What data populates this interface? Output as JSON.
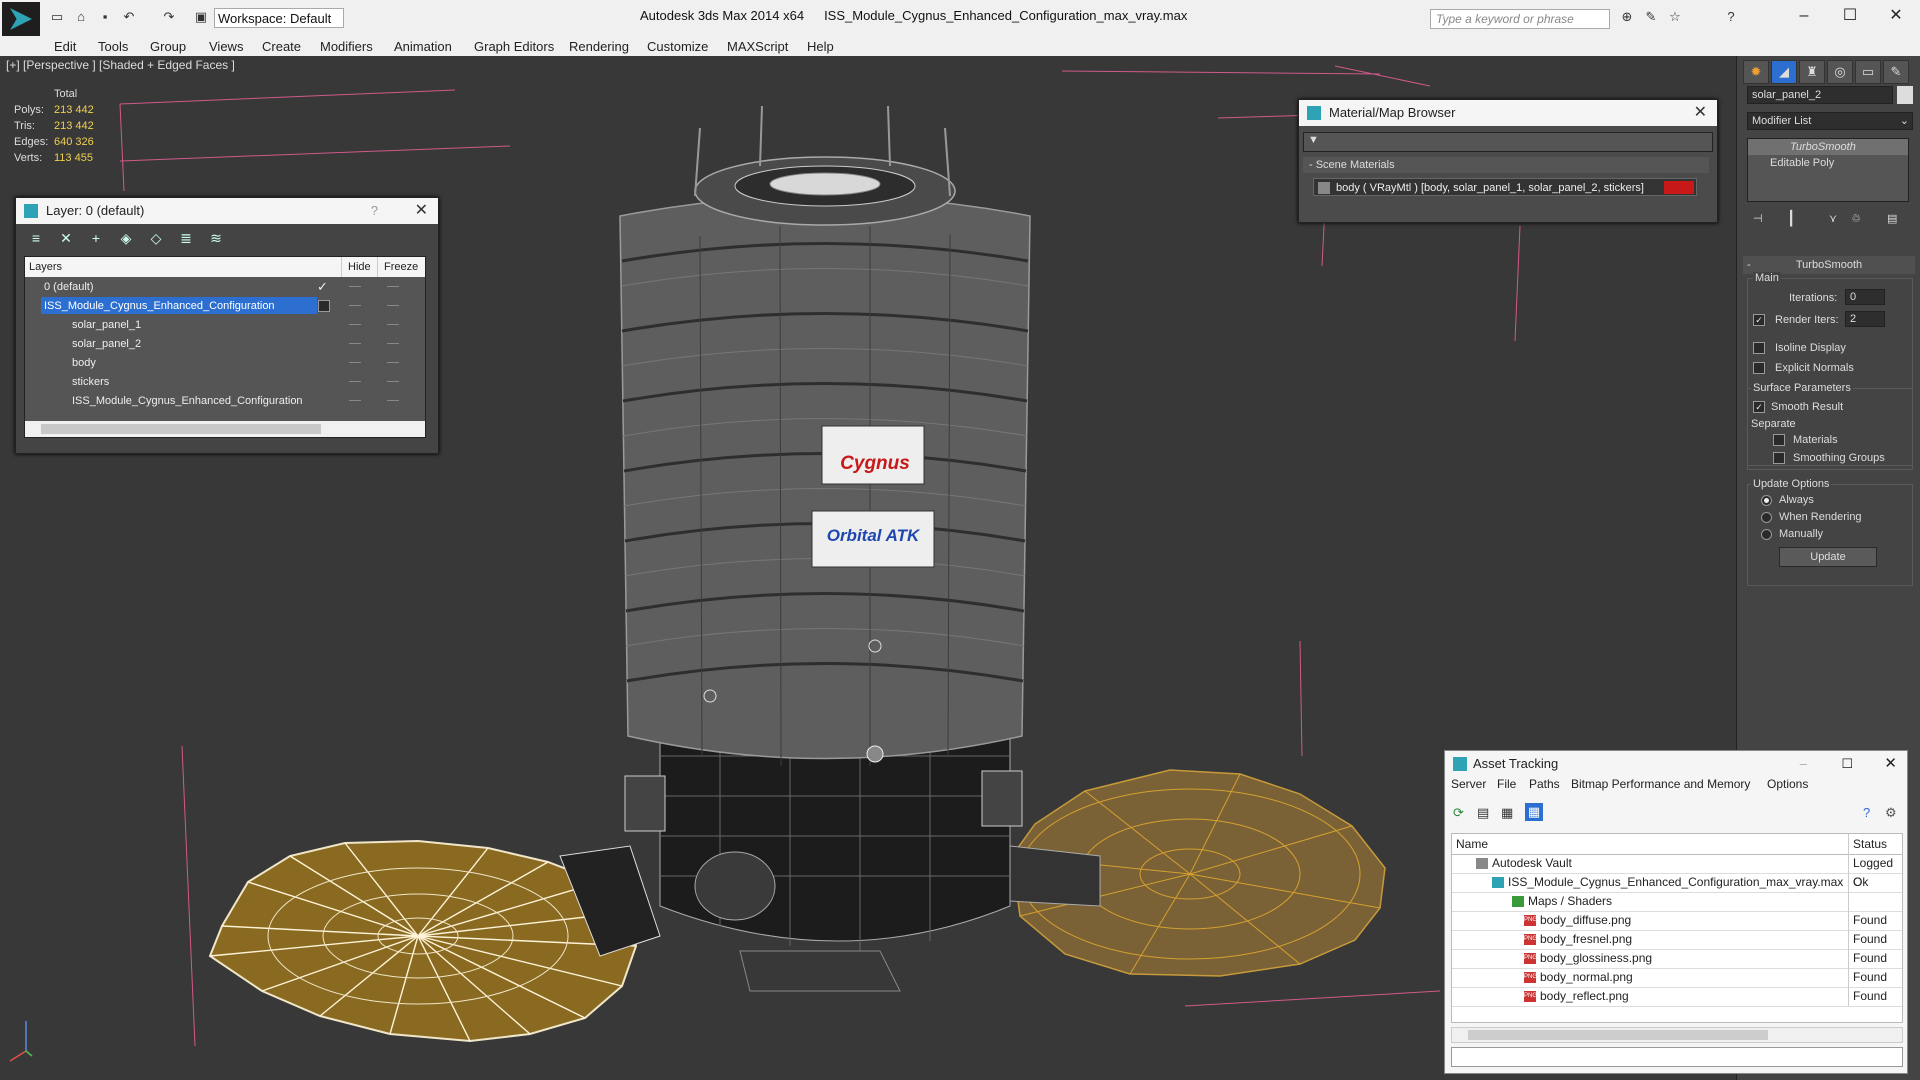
{
  "app": {
    "title": "Autodesk 3ds Max  2014 x64",
    "filename": "ISS_Module_Cygnus_Enhanced_Configuration_max_vray.max",
    "workspace": "Workspace: Default",
    "search_placeholder": "Type a keyword or phrase"
  },
  "menu": [
    "Edit",
    "Tools",
    "Group",
    "Views",
    "Create",
    "Modifiers",
    "Animation",
    "Graph Editors",
    "Rendering",
    "Customize",
    "MAXScript",
    "Help"
  ],
  "viewport": {
    "label": "[+] [Perspective ] [Shaded + Edged Faces ]",
    "stats": {
      "header": "Total",
      "rows": [
        {
          "k": "Polys:",
          "v": "213 442"
        },
        {
          "k": "Tris:",
          "v": "213 442"
        },
        {
          "k": "Edges:",
          "v": "640 326"
        },
        {
          "k": "Verts:",
          "v": "113 455"
        }
      ]
    },
    "decals": [
      "Cygnus",
      "Orbital ATK"
    ]
  },
  "layer_panel": {
    "title": "Layer: 0 (default)",
    "help": "?",
    "col_layers": "Layers",
    "col_hide": "Hide",
    "col_freeze": "Freeze",
    "rows": [
      {
        "name": "0 (default)",
        "indent": 0
      },
      {
        "name": "ISS_Module_Cygnus_Enhanced_Configuration",
        "indent": 0,
        "selected": true
      },
      {
        "name": "solar_panel_1",
        "indent": 1
      },
      {
        "name": "solar_panel_2",
        "indent": 1
      },
      {
        "name": "body",
        "indent": 1
      },
      {
        "name": "stickers",
        "indent": 1
      },
      {
        "name": "ISS_Module_Cygnus_Enhanced_Configuration",
        "indent": 1
      }
    ]
  },
  "material_browser": {
    "title": "Material/Map Browser",
    "section": "- Scene Materials",
    "item": "body  ( VRayMtl ) [body, solar_panel_1, solar_panel_2, stickers]",
    "swatch_color": "#c81818"
  },
  "command_panel": {
    "object_name": "solar_panel_2",
    "modifier_list": "Modifier List",
    "stack": [
      "TurboSmooth",
      "Editable Poly"
    ],
    "rollout_title": "TurboSmooth",
    "main_label": "Main",
    "iterations_label": "Iterations:",
    "iterations_value": "0",
    "render_iters_label": "Render Iters:",
    "render_iters_value": "2",
    "isoline": "Isoline Display",
    "explicit_normals": "Explicit Normals",
    "surface_params": "Surface Parameters",
    "smooth_result": "Smooth Result",
    "separate": "Separate",
    "materials": "Materials",
    "smoothing_groups": "Smoothing Groups",
    "update_options": "Update Options",
    "always": "Always",
    "when_rendering": "When Rendering",
    "manually": "Manually",
    "update_btn": "Update"
  },
  "asset_tracking": {
    "title": "Asset Tracking",
    "menu": [
      "Server",
      "File",
      "Paths",
      "Bitmap Performance and Memory",
      "Options"
    ],
    "col_name": "Name",
    "col_status": "Status",
    "rows": [
      {
        "name": "Autodesk Vault",
        "status": "Logged O",
        "indent": 1,
        "icon": "vault"
      },
      {
        "name": "ISS_Module_Cygnus_Enhanced_Configuration_max_vray.max",
        "status": "Ok",
        "indent": 2,
        "icon": "max"
      },
      {
        "name": "Maps / Shaders",
        "status": "",
        "indent": 3,
        "icon": "folder"
      },
      {
        "name": "body_diffuse.png",
        "status": "Found",
        "indent": 4,
        "icon": "png"
      },
      {
        "name": "body_fresnel.png",
        "status": "Found",
        "indent": 4,
        "icon": "png"
      },
      {
        "name": "body_glossiness.png",
        "status": "Found",
        "indent": 4,
        "icon": "png"
      },
      {
        "name": "body_normal.png",
        "status": "Found",
        "indent": 4,
        "icon": "png"
      },
      {
        "name": "body_reflect.png",
        "status": "Found",
        "indent": 4,
        "icon": "png"
      }
    ]
  }
}
